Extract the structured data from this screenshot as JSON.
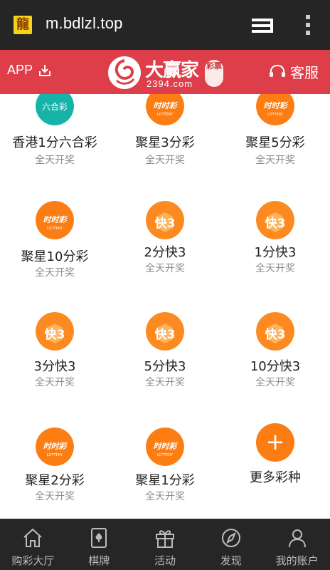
{
  "browser": {
    "favicon_glyph": "龍",
    "url": "m.bdlzl.top"
  },
  "header": {
    "app_label": "APP",
    "logo_name": "大赢家",
    "logo_domain": "2394.com",
    "logo_badge": "彩票",
    "service_label": "客服",
    "accent_color": "#de3e49"
  },
  "games": [
    {
      "title": "香港1分六合彩",
      "subtitle": "全天开奖",
      "icon": "liuhecai-icon"
    },
    {
      "title": "聚星3分彩",
      "subtitle": "全天开奖",
      "icon": "shishicai-icon"
    },
    {
      "title": "聚星5分彩",
      "subtitle": "全天开奖",
      "icon": "shishicai-icon"
    },
    {
      "title": "聚星10分彩",
      "subtitle": "全天开奖",
      "icon": "shishicai-icon"
    },
    {
      "title": "2分快3",
      "subtitle": "全天开奖",
      "icon": "kuai3-icon"
    },
    {
      "title": "1分快3",
      "subtitle": "全天开奖",
      "icon": "kuai3-icon"
    },
    {
      "title": "3分快3",
      "subtitle": "全天开奖",
      "icon": "kuai3-icon"
    },
    {
      "title": "5分快3",
      "subtitle": "全天开奖",
      "icon": "kuai3-icon"
    },
    {
      "title": "10分快3",
      "subtitle": "全天开奖",
      "icon": "kuai3-icon"
    },
    {
      "title": "聚星2分彩",
      "subtitle": "全天开奖",
      "icon": "shishicai-icon"
    },
    {
      "title": "聚星1分彩",
      "subtitle": "全天开奖",
      "icon": "shishicai-icon"
    },
    {
      "title": "更多彩种",
      "subtitle": "",
      "icon": "plus-icon"
    }
  ],
  "nav": [
    {
      "label": "购彩大厅",
      "icon": "home-icon"
    },
    {
      "label": "棋牌",
      "icon": "cards-icon"
    },
    {
      "label": "活动",
      "icon": "gift-icon"
    },
    {
      "label": "发现",
      "icon": "compass-icon"
    },
    {
      "label": "我的账户",
      "icon": "user-icon"
    }
  ],
  "colors": {
    "orange": "#fb7d14",
    "teal": "#17b3a8",
    "nav_bg": "#262626"
  }
}
